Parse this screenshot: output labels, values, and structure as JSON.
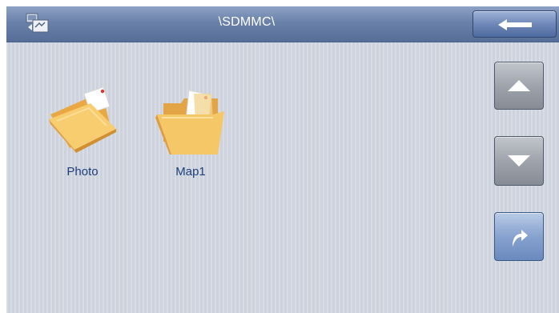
{
  "titlebar": {
    "path": "\\SDMMC\\",
    "app_icon": "file-explorer-icon",
    "back_icon": "arrow-left-icon"
  },
  "folders": [
    {
      "name": "Photo",
      "icon": "folder-closed-icon"
    },
    {
      "name": "Map1",
      "icon": "folder-open-icon"
    }
  ],
  "side_buttons": [
    {
      "icon": "triangle-up-icon"
    },
    {
      "icon": "triangle-down-icon"
    },
    {
      "icon": "curved-arrow-forward-icon"
    }
  ],
  "colors": {
    "background": "#cdd2dc",
    "titlebar": "#6a81a9",
    "label_text": "#1e3f7a",
    "folder": "#f3c56a"
  }
}
